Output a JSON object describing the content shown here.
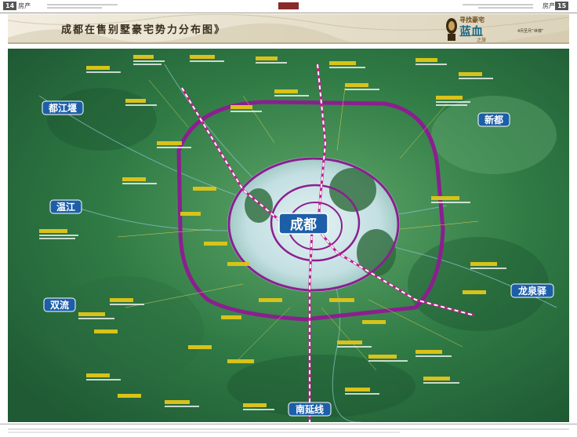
{
  "header": {
    "page_left": "14",
    "section_left": "房产",
    "page_right": "15",
    "section_right": "房产"
  },
  "title": "成都在售别墅豪宅势力分布图》",
  "logo": {
    "line1": "寻找豪宅",
    "line2": "蓝血",
    "line3": "之旅",
    "tagline": "4月至月“世博”"
  },
  "map": {
    "center_label": "成都",
    "region_labels": [
      {
        "id": "dujiangyan",
        "text": "都江堰"
      },
      {
        "id": "xindu",
        "text": "新都"
      },
      {
        "id": "wenjiang",
        "text": "温江"
      },
      {
        "id": "shuangliu",
        "text": "双流"
      },
      {
        "id": "longquanyi",
        "text": "龙泉驿"
      },
      {
        "id": "nanyan",
        "text": "南延线"
      }
    ],
    "colors": {
      "ring": "#8b1f8f",
      "road_dash": "#ffffff",
      "road_base": "#c0208f",
      "label_bg": "#1c5fa8",
      "label_text": "#ffffff",
      "green_dark": "#1f5a34",
      "green_light": "#5fa86a",
      "city": "#cfe6ea",
      "callout_box": "#d9c21a"
    }
  }
}
